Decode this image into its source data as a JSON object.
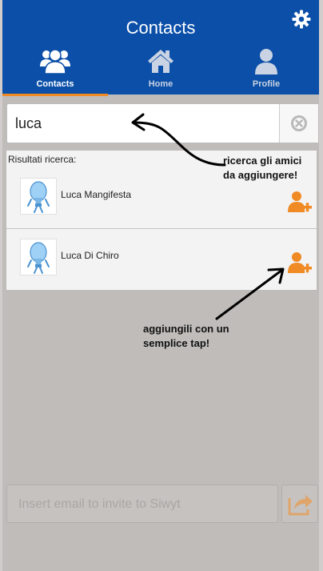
{
  "header": {
    "title": "Contacts",
    "settings_icon": "gear-icon",
    "tabs": [
      {
        "label": "Contacts",
        "icon": "users-icon",
        "active": true
      },
      {
        "label": "Home",
        "icon": "home-icon",
        "active": false
      },
      {
        "label": "Profile",
        "icon": "user-icon",
        "active": false
      }
    ]
  },
  "search": {
    "value": "luca",
    "clear_icon": "clear-circle-icon"
  },
  "results": {
    "heading": "Risultati ricerca:",
    "items": [
      {
        "name": "Luca Mangifesta",
        "avatar": "lightbulb-avatar",
        "action_icon": "add-user-icon"
      },
      {
        "name": "Luca Di Chiro",
        "avatar": "lightbulb-avatar",
        "action_icon": "add-user-icon"
      }
    ]
  },
  "annotations": {
    "search_note_line1": "ricerca gli amici",
    "search_note_line2": "da aggiungere!",
    "add_note_line1": "aggiungili con un",
    "add_note_line2": "semplice tap!"
  },
  "invite": {
    "placeholder": "Insert email to invite to Siwyt",
    "send_icon": "share-icon"
  },
  "colors": {
    "header_bg": "#0b4fa8",
    "accent": "#f08a24",
    "add_icon": "#f08a24"
  }
}
